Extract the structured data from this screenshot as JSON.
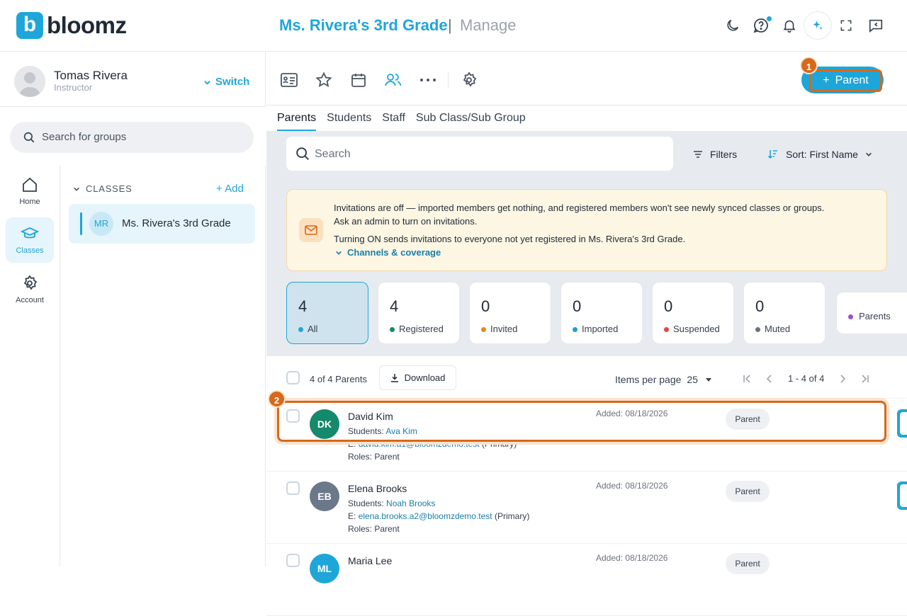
{
  "header": {
    "logo_letter": "b",
    "logo_text": "bloomz",
    "class_title": "Ms. Rivera's 3rd Grade",
    "separator": "|",
    "section": "Manage"
  },
  "user": {
    "name": "Tomas Rivera",
    "role": "Instructor",
    "switch_label": "Switch"
  },
  "group_search": {
    "placeholder": "Search for groups"
  },
  "left_nav": [
    {
      "label": "Home",
      "icon": "home-icon"
    },
    {
      "label": "Classes",
      "icon": "graduation-cap-icon",
      "active": true
    },
    {
      "label": "Account",
      "icon": "gear-icon"
    }
  ],
  "classes_panel": {
    "header": "CLASSES",
    "add_label": "+ Add",
    "items": [
      {
        "initials": "MR",
        "label": "Ms. Rivera's 3rd Grade"
      }
    ]
  },
  "toolbar": {
    "add_parent_label": "Parent",
    "step1": "1"
  },
  "tabs": [
    "Parents",
    "Students",
    "Staff",
    "Sub Class/Sub Group"
  ],
  "search": {
    "placeholder": "Search"
  },
  "filters_label": "Filters",
  "sort_label": "Sort: First Name",
  "banner": {
    "line1": "Invitations are off — imported members get nothing, and registered members won't see newly synced classes or groups.",
    "line2": "Ask an admin to turn on invitations.",
    "line3": "Turning ON sends invitations to everyone not yet registered in Ms. Rivera's 3rd Grade.",
    "link": "Channels & coverage"
  },
  "stats": [
    {
      "num": "4",
      "label": "All",
      "color": "#1ea6d9"
    },
    {
      "num": "4",
      "label": "Registered",
      "color": "#15896b"
    },
    {
      "num": "0",
      "label": "Invited",
      "color": "#e08a1e"
    },
    {
      "num": "0",
      "label": "Imported",
      "color": "#1a9fd0"
    },
    {
      "num": "0",
      "label": "Suspended",
      "color": "#e0483c"
    },
    {
      "num": "0",
      "label": "Muted",
      "color": "#6b7280"
    }
  ],
  "legend": {
    "label": "Parents",
    "color": "#9b4fd9"
  },
  "list": {
    "count_text": "4 of 4 Parents",
    "download_label": "Download",
    "items_per_page_label": "Items per page",
    "items_per_page_value": "25",
    "range": "1 - 4 of 4",
    "step2": "2"
  },
  "rows": [
    {
      "initials": "DK",
      "color": "#15896b",
      "name": "David Kim",
      "students_label": "Students:",
      "student": "Ava Kim",
      "email_label": "E:",
      "email": "david.kim.a1@bloomzdemo.test",
      "email_note": "(Primary)",
      "roles": "Roles: Parent",
      "added": "Added: 08/18/2026",
      "role": "Parent"
    },
    {
      "initials": "EB",
      "color": "#6b7889",
      "name": "Elena Brooks",
      "students_label": "Students:",
      "student": "Noah Brooks",
      "email_label": "E:",
      "email": "elena.brooks.a2@bloomzdemo.test",
      "email_note": "(Primary)",
      "roles": "Roles: Parent",
      "added": "Added: 08/18/2026",
      "role": "Parent"
    },
    {
      "initials": "ML",
      "color": "#1ea6d9",
      "name": "Maria Lee",
      "students_label": "",
      "student": "",
      "email_label": "",
      "email": "",
      "email_note": "",
      "roles": "",
      "added": "Added: 08/18/2026",
      "role": "Parent"
    }
  ]
}
